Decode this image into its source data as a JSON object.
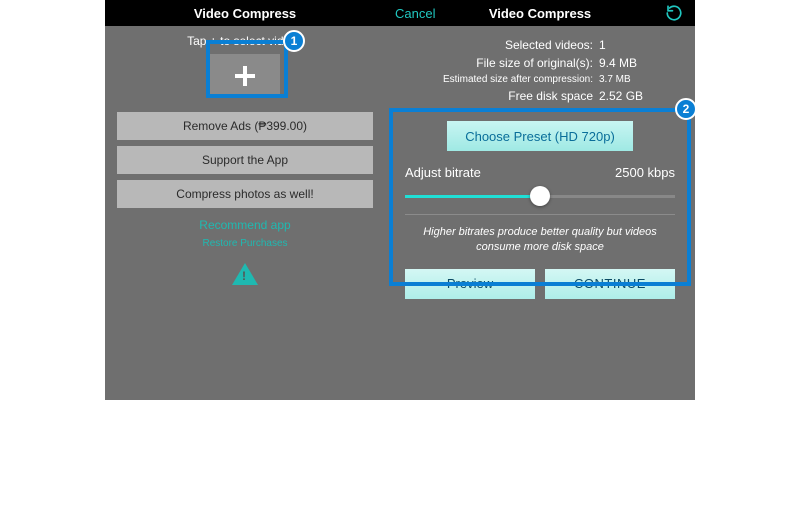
{
  "colors": {
    "teal": "#1fb9b1",
    "highlight": "#0a7fd4"
  },
  "left": {
    "title": "Video Compress",
    "tap_hint": "Tap + to select videos",
    "buttons": {
      "remove_ads": "Remove Ads (₱399.00)",
      "support": "Support the App",
      "compress_photos": "Compress photos as well!"
    },
    "links": {
      "recommend": "Recommend app",
      "restore": "Restore Purchases"
    }
  },
  "right": {
    "cancel": "Cancel",
    "title": "Video Compress",
    "info": {
      "selected_label": "Selected videos:",
      "selected_value": "1",
      "orig_label": "File size of original(s):",
      "orig_value": "9.4 MB",
      "est_label": "Estimated size after compression:",
      "est_value": "3.7 MB",
      "free_label": "Free disk space",
      "free_value": "2.52 GB"
    },
    "preset_button": "Choose Preset (HD 720p)",
    "bitrate_label": "Adjust bitrate",
    "bitrate_value": "2500 kbps",
    "hint": "Higher bitrates produce better quality but videos consume more disk space",
    "preview": "Preview",
    "continue": "CONTINUE"
  },
  "annotations": {
    "one": "1",
    "two": "2"
  }
}
